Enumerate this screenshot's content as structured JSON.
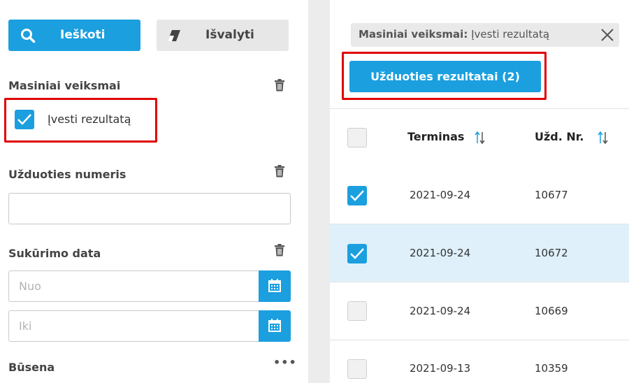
{
  "filters": {
    "search_label": "Ieškoti",
    "clear_label": "Išvalyti",
    "mass_actions": {
      "title": "Masiniai veiksmai",
      "option_label": "Įvesti rezultatą",
      "option_checked": true
    },
    "task_number": {
      "title": "Užduoties numeris",
      "value": ""
    },
    "created_date": {
      "title": "Sukūrimo data",
      "from_placeholder": "Nuo",
      "to_placeholder": "Iki"
    },
    "status": {
      "title": "Būsena",
      "more_label": "•••"
    }
  },
  "results": {
    "active_filter_tag": {
      "key": "Masiniai veiksmai:",
      "value": "Įvesti rezultatą"
    },
    "results_button_label": "Užduoties rezultatai (2)",
    "columns": [
      "Terminas",
      "Užd. Nr."
    ],
    "rows": [
      {
        "checked": true,
        "deadline": "2021-09-24",
        "task_no": "10677"
      },
      {
        "checked": true,
        "deadline": "2021-09-24",
        "task_no": "10672"
      },
      {
        "checked": false,
        "deadline": "2021-09-24",
        "task_no": "10669"
      },
      {
        "checked": false,
        "deadline": "2021-09-13",
        "task_no": "10359"
      }
    ]
  },
  "colors": {
    "accent": "#1b9fdf",
    "highlight": "#e10000",
    "selected_row": "#dff0fa"
  }
}
